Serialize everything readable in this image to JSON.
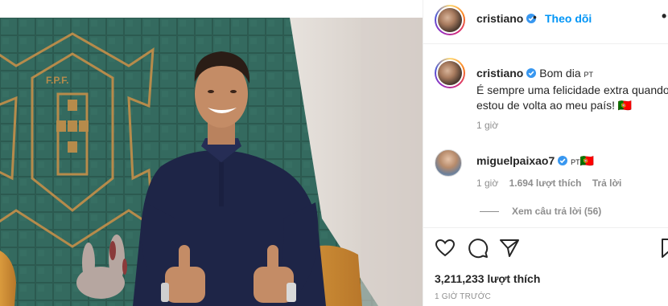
{
  "post": {
    "author": "cristiano",
    "follow_label": "Theo dõi",
    "more_label": "•••",
    "dot": "•"
  },
  "photo": {
    "crest_text": "F.P.F."
  },
  "caption": {
    "username": "cristiano",
    "greeting": "Bom dia",
    "lang_tag": "PT",
    "line1": "É sempre uma felicidade extra quando",
    "line2": "estou de volta ao meu país! 🇵🇹",
    "time": "1 giờ"
  },
  "comment": {
    "username": "miguelpaixao7",
    "lang_tag": "PT",
    "text": "🇵🇹",
    "time": "1 giờ",
    "likes": "1.694 lượt thích",
    "reply_label": "Trả lời",
    "view_replies": "Xem câu trả lời (56)"
  },
  "actions": {
    "likes": "3,211,233 lượt thích",
    "posted": "1 GIỜ TRƯỚC"
  },
  "icons": {
    "verified": "verified-badge-icon",
    "like": "heart-icon",
    "comment": "comment-bubble-icon",
    "share": "paper-plane-icon",
    "save": "bookmark-icon"
  },
  "colors": {
    "link": "#0095f6",
    "verified": "#3897f0",
    "muted": "#8e8e8e",
    "text": "#262626"
  }
}
